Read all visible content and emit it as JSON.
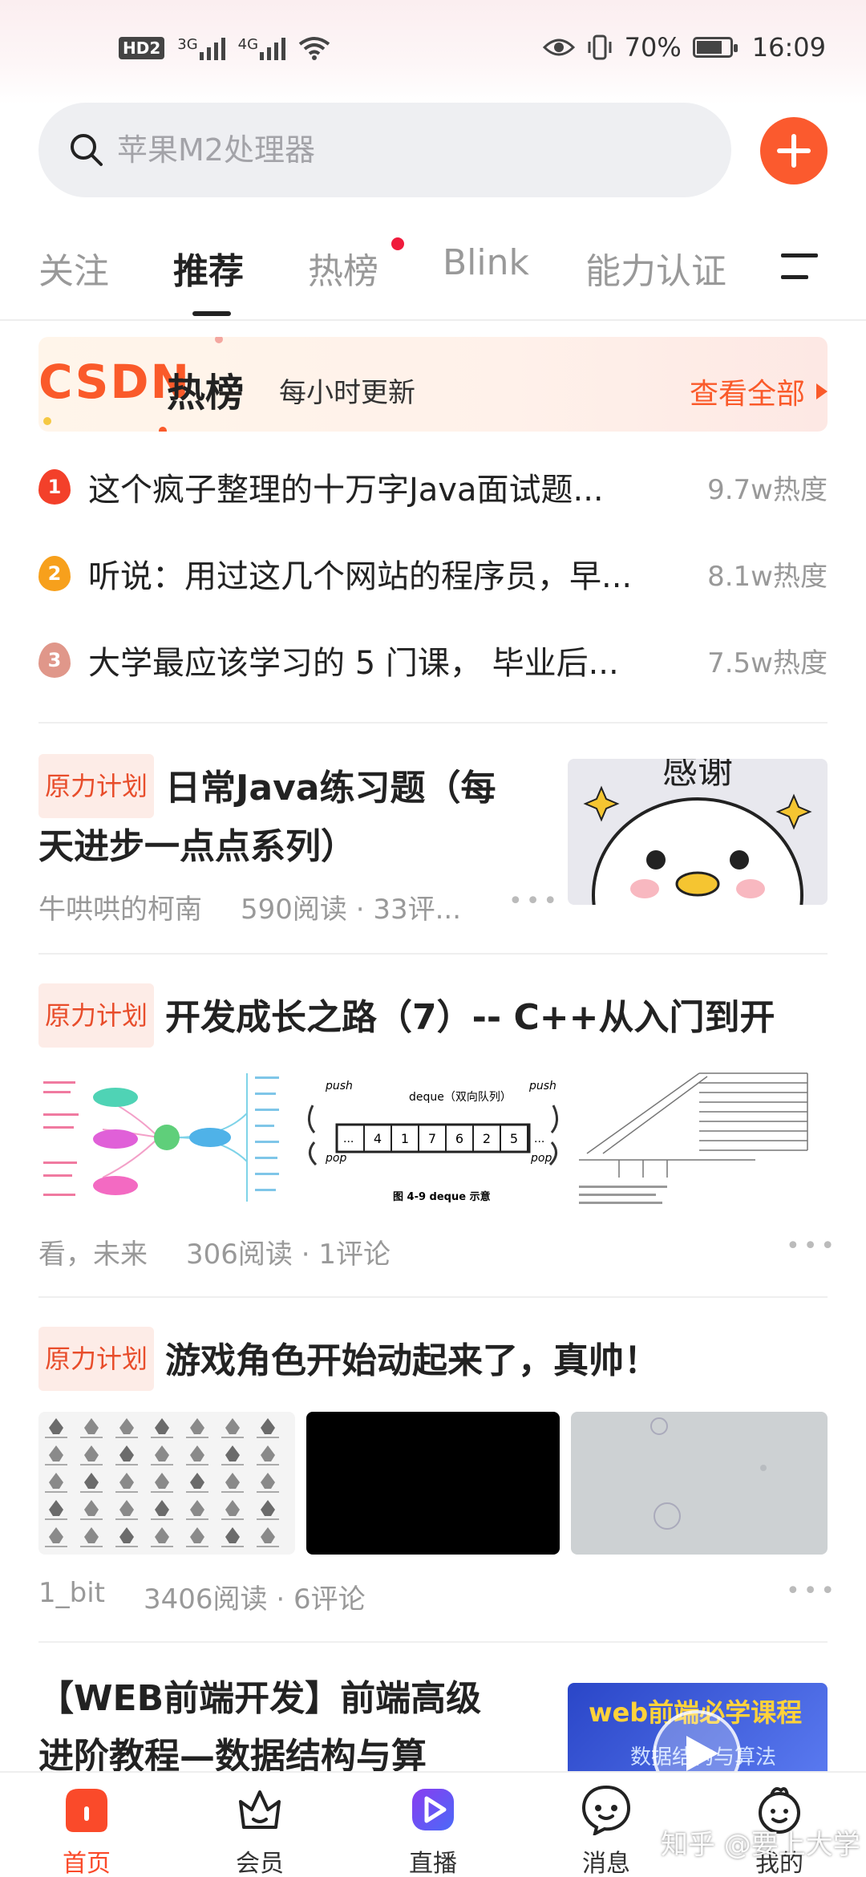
{
  "status_bar": {
    "hd_badge": "HD2",
    "signal_1": "3G",
    "signal_2": "4G",
    "battery": "70%",
    "time": "16:09"
  },
  "search": {
    "placeholder": "苹果M2处理器"
  },
  "tabs": [
    {
      "label": "关注"
    },
    {
      "label": "推荐"
    },
    {
      "label": "热榜"
    },
    {
      "label": "Blink"
    },
    {
      "label": "能力认证"
    }
  ],
  "hot": {
    "logo": "CSDN",
    "title": "热榜",
    "subtitle": "每小时更新",
    "view_all": "查看全部",
    "items": [
      {
        "rank": "1",
        "title": "这个疯子整理的十万字Java面试题...",
        "heat": "9.7w热度"
      },
      {
        "rank": "2",
        "title": "听说：用过这几个网站的程序员，早...",
        "heat": "8.1w热度"
      },
      {
        "rank": "3",
        "title": "大学最应该学习的 5 门课， 毕业后...",
        "heat": "7.5w热度"
      }
    ]
  },
  "articles": [
    {
      "tag": "原力计划",
      "title": "日常Java练习题（每天进步一点点系列）",
      "title_line1": "日常Java练习题（每",
      "title_line2": "天进步一点点系列）",
      "author": "牛哄哄的柯南",
      "stats": "590阅读 · 33评...",
      "thumb_text": "感谢"
    },
    {
      "tag": "原力计划",
      "title": "开发成长之路（7）-- C++从入门到开",
      "author": "看，未来",
      "stats": "306阅读 · 1评论",
      "deque_title": "deque（双向队列）",
      "deque_caption": "图 4-9   deque 示意",
      "deque_push": "push",
      "deque_pop": "pop",
      "deque_values": [
        "4",
        "1",
        "7",
        "6",
        "2",
        "5"
      ]
    },
    {
      "tag": "原力计划",
      "title": "游戏角色开始动起来了，真帅！",
      "author": "1_bit",
      "stats": "3406阅读 · 6评论"
    },
    {
      "title_line1": "【WEB前端开发】前端高级",
      "title_line2": "进阶教程—数据结构与算",
      "thumb_title": "web前端必学课程",
      "thumb_sub": "数据结构与算法"
    }
  ],
  "bottom_nav": [
    {
      "label": "首页"
    },
    {
      "label": "会员"
    },
    {
      "label": "直播"
    },
    {
      "label": "消息"
    },
    {
      "label": "我的"
    }
  ],
  "watermark": "知乎 @要上大学",
  "colors": {
    "accent": "#fa5a2a",
    "tag_bg": "#fdece7",
    "red_dot": "#f01b3c"
  }
}
